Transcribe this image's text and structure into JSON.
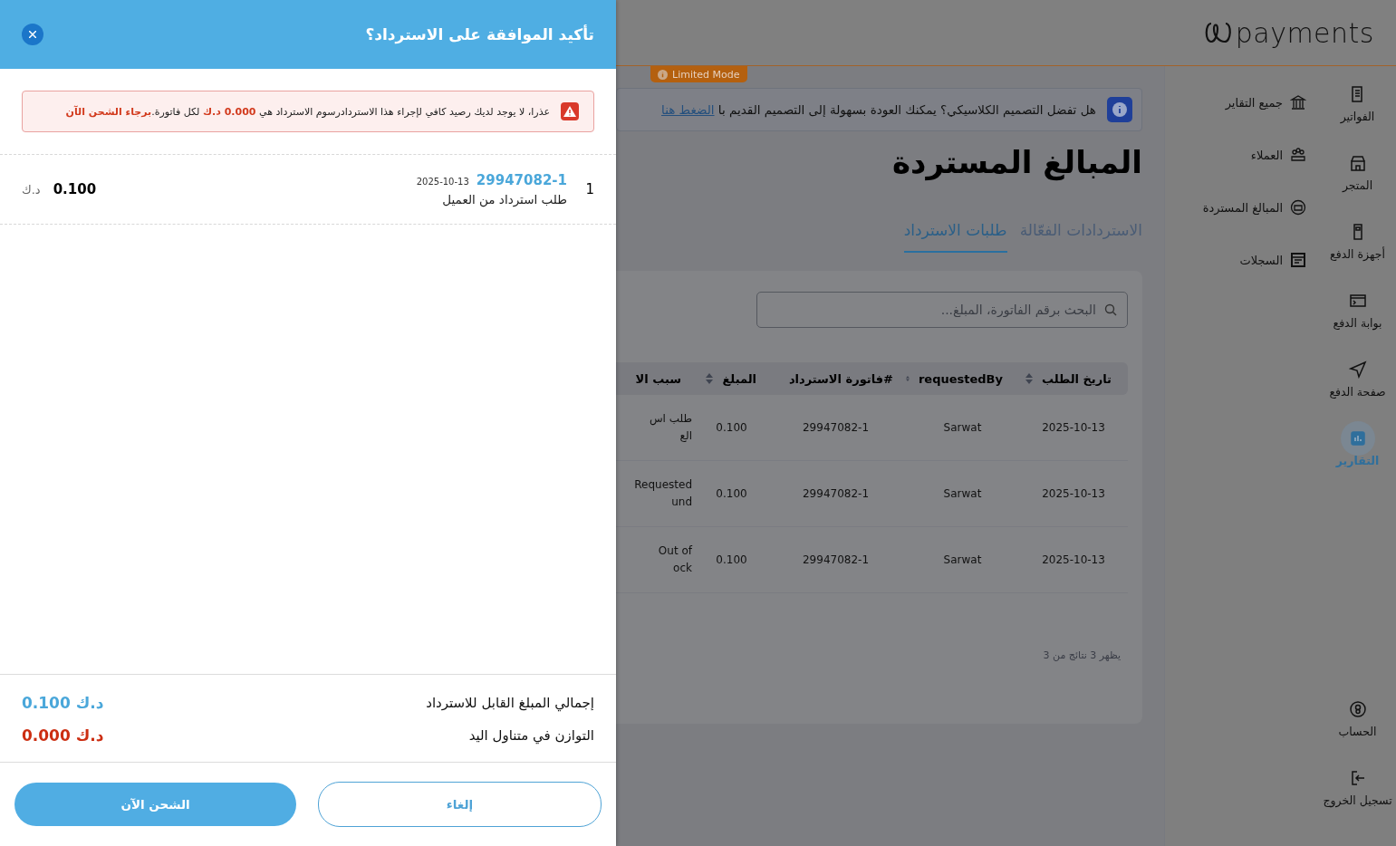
{
  "header": {
    "logo": "payments"
  },
  "rail": {
    "items": [
      {
        "label": "الفواتير",
        "kind": "invoice",
        "selected": false
      },
      {
        "label": "المتجر",
        "kind": "store",
        "selected": false
      },
      {
        "label": "أجهزة الدفع",
        "kind": "terminal",
        "selected": false
      },
      {
        "label": "بوابة الدفع",
        "kind": "console",
        "selected": false
      },
      {
        "label": "صفحة الدفع",
        "kind": "send",
        "selected": false
      },
      {
        "label": "التقارير",
        "kind": "chart",
        "selected": true
      }
    ],
    "bottom_items": [
      {
        "label": "الحساب",
        "kind": "account"
      },
      {
        "label": "تسجيل الخروج",
        "kind": "logout"
      }
    ]
  },
  "submenu": [
    {
      "label": "جميع التقاير",
      "kind": "bank"
    },
    {
      "label": "العملاء",
      "kind": "people"
    },
    {
      "label": "المبالغ المستردة",
      "kind": "refund"
    },
    {
      "label": "السجلات",
      "kind": "log"
    }
  ],
  "badge": "Limited Mode",
  "banner": {
    "text": "هل تفضل التصميم الكلاسيكي؟ يمكنك العودة بسهولة إلى التصميم القديم با",
    "link": "الضغط هنا"
  },
  "page_title": "المبالغ المستردة",
  "tabs": [
    {
      "label": "الاستردادات الفعّالة",
      "selected": false
    },
    {
      "label": "طلبات الاسترداد",
      "selected": true
    }
  ],
  "search": {
    "placeholder": "البحث برقم الفاتورة، المبلغ..."
  },
  "table": {
    "columns": [
      {
        "label": "تاريخ الطلب",
        "sortable": true
      },
      {
        "label": "requestedBy",
        "sortable": true
      },
      {
        "label": "#فاتورة الاسترداد",
        "sortable": false
      },
      {
        "label": "المبلغ",
        "sortable": true
      },
      {
        "label": "سبب الا",
        "sortable": false
      }
    ],
    "rows": [
      [
        "2025-10-13",
        "Sarwat",
        "29947082-1",
        "0.100",
        "طلب اس\nالع"
      ],
      [
        "2025-10-13",
        "Sarwat",
        "29947082-1",
        "0.100",
        "Requested\nund"
      ],
      [
        "2025-10-13",
        "Sarwat",
        "29947082-1",
        "0.100",
        "Out of\nock"
      ]
    ]
  },
  "results": "يظهر 3 نتائج من 3",
  "drawer": {
    "title": "تأكيد الموافقة على الاسترداد؟",
    "alert": "عذرا، لا يوجد لديك رصيد كافي لإجراء هذا الاستردادرسوم الاسترداد هي **0.000 د.ك** لكل فاتورة.**برجاء الشحن الآن**",
    "items": [
      {
        "index": "1",
        "invoice": "29947082-1",
        "date": "2025-10-13",
        "description": "طلب استرداد من العميل",
        "amount": "0.100",
        "currency": "د.ك"
      }
    ],
    "summary": [
      {
        "label": "إجمالي المبلغ القابل للاسترداد",
        "value": "0.100 د.ك",
        "kind": "total"
      },
      {
        "label": "التوازن في متناول اليد",
        "value": "0.000 د.ك",
        "kind": "balance"
      }
    ],
    "buttons": [
      {
        "label": "إلغاء",
        "kind": "secondary"
      },
      {
        "label": "الشحن الآن",
        "kind": "primary"
      }
    ]
  }
}
